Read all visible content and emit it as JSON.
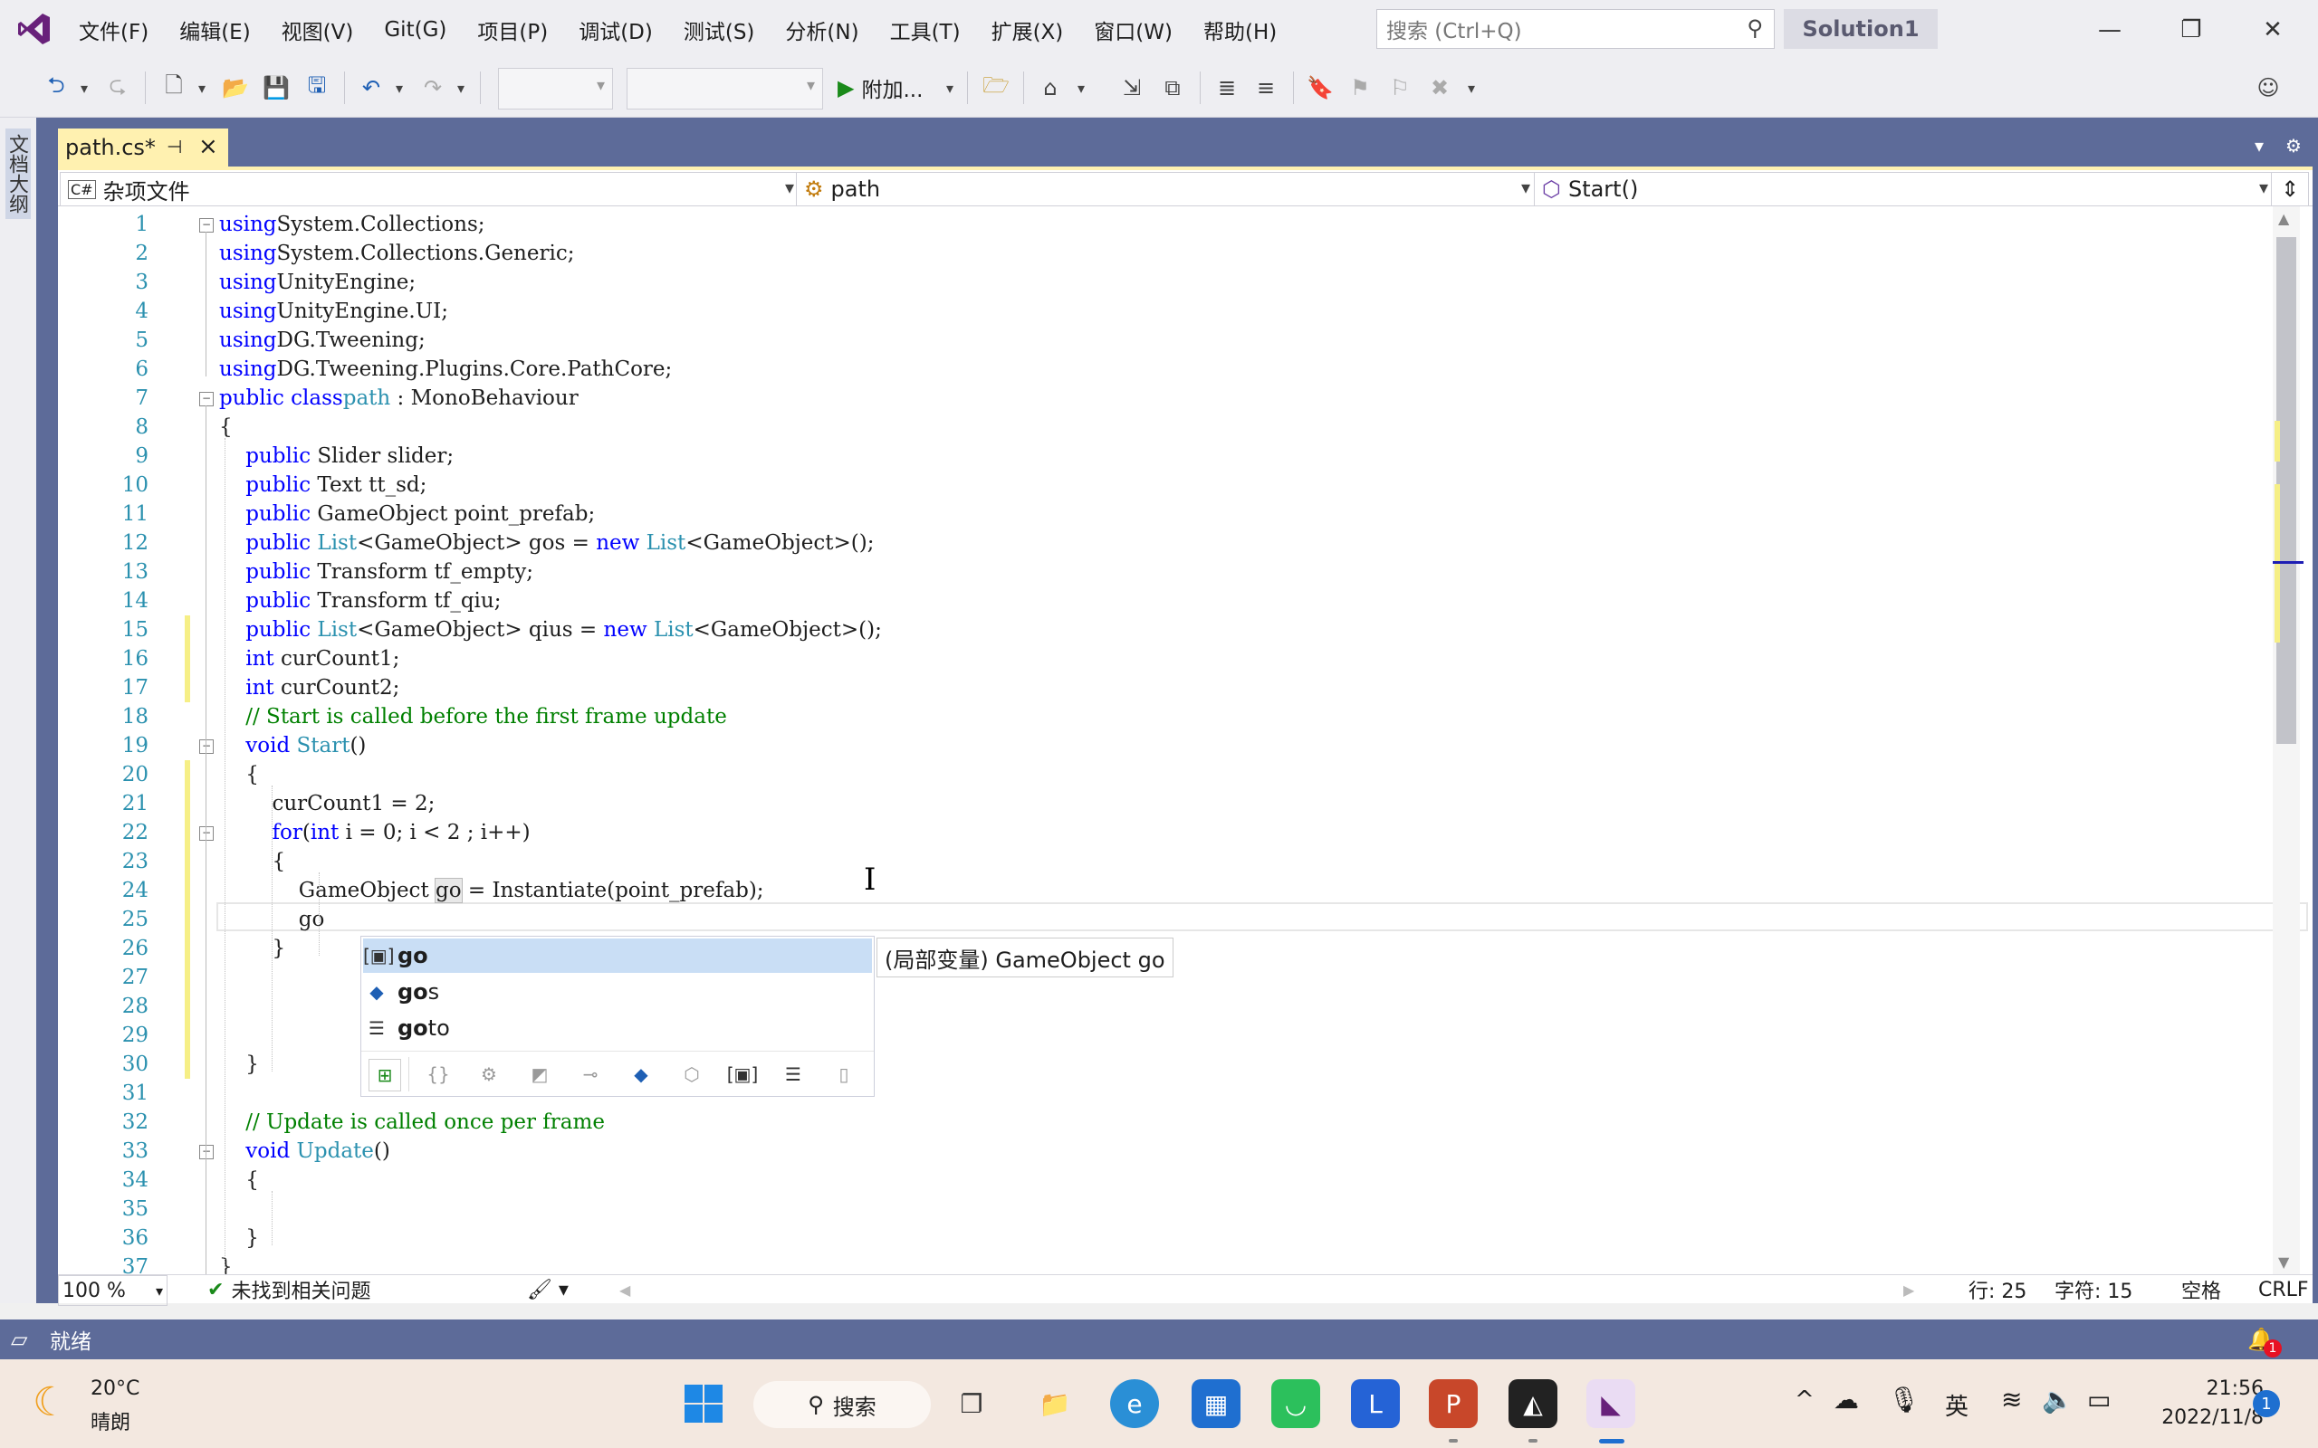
{
  "titlebar": {
    "menus": [
      "文件(F)",
      "编辑(E)",
      "视图(V)",
      "Git(G)",
      "项目(P)",
      "调试(D)",
      "测试(S)",
      "分析(N)",
      "工具(T)",
      "扩展(X)",
      "窗口(W)",
      "帮助(H)"
    ],
    "search_placeholder": "搜索 (Ctrl+Q)",
    "solution": "Solution1"
  },
  "toolbar": {
    "attach_label": "附加..."
  },
  "left_panel_label": "文档大纲",
  "tab": {
    "title": "path.cs*"
  },
  "navbar": {
    "project": "杂项文件",
    "class": "path",
    "member": "Start()"
  },
  "code_lines": [
    {
      "n": "1",
      "p": [
        [
          "kw",
          "using"
        ],
        [
          "",
          "System.Collections;"
        ]
      ]
    },
    {
      "n": "2",
      "p": [
        [
          "kw",
          "using"
        ],
        [
          "",
          "System.Collections.Generic;"
        ]
      ]
    },
    {
      "n": "3",
      "p": [
        [
          "kw",
          "using"
        ],
        [
          "",
          "UnityEngine;"
        ]
      ]
    },
    {
      "n": "4",
      "p": [
        [
          "kw",
          "using"
        ],
        [
          "",
          "UnityEngine.UI;"
        ]
      ]
    },
    {
      "n": "5",
      "p": [
        [
          "kw",
          "using"
        ],
        [
          "",
          "DG.Tweening;"
        ]
      ]
    },
    {
      "n": "6",
      "p": [
        [
          "kw",
          "using"
        ],
        [
          "",
          "DG.Tweening.Plugins.Core.PathCore;"
        ]
      ]
    },
    {
      "n": "7",
      "p": [
        [
          "kw",
          "public class"
        ],
        [
          "ty",
          "path"
        ],
        [
          "",
          " : MonoBehaviour"
        ]
      ]
    },
    {
      "n": "8",
      "p": [
        [
          "",
          "{"
        ]
      ]
    },
    {
      "n": "9",
      "p": [
        [
          "",
          "    "
        ],
        [
          "kw",
          "public"
        ],
        [
          "",
          " Slider slider;"
        ]
      ]
    },
    {
      "n": "10",
      "p": [
        [
          "",
          "    "
        ],
        [
          "kw",
          "public"
        ],
        [
          "",
          " Text tt_sd;"
        ]
      ]
    },
    {
      "n": "11",
      "p": [
        [
          "",
          "    "
        ],
        [
          "kw",
          "public"
        ],
        [
          "",
          " GameObject point_prefab;"
        ]
      ]
    },
    {
      "n": "12",
      "p": [
        [
          "",
          "    "
        ],
        [
          "kw",
          "public"
        ],
        [
          "",
          " "
        ],
        [
          "ty",
          "List"
        ],
        [
          "",
          "<GameObject> gos = "
        ],
        [
          "kw",
          "new"
        ],
        [
          "",
          " "
        ],
        [
          "ty",
          "List"
        ],
        [
          "",
          "<GameObject>();"
        ]
      ]
    },
    {
      "n": "13",
      "p": [
        [
          "",
          "    "
        ],
        [
          "kw",
          "public"
        ],
        [
          "",
          " Transform tf_empty;"
        ]
      ]
    },
    {
      "n": "14",
      "p": [
        [
          "",
          "    "
        ],
        [
          "kw",
          "public"
        ],
        [
          "",
          " Transform tf_qiu;"
        ]
      ]
    },
    {
      "n": "15",
      "p": [
        [
          "",
          "    "
        ],
        [
          "kw",
          "public"
        ],
        [
          "",
          " "
        ],
        [
          "ty",
          "List"
        ],
        [
          "",
          "<GameObject> qius = "
        ],
        [
          "kw",
          "new"
        ],
        [
          "",
          " "
        ],
        [
          "ty",
          "List"
        ],
        [
          "",
          "<GameObject>();"
        ]
      ]
    },
    {
      "n": "16",
      "p": [
        [
          "",
          "    "
        ],
        [
          "kw",
          "int"
        ],
        [
          "",
          " curCount1;"
        ]
      ]
    },
    {
      "n": "17",
      "p": [
        [
          "",
          "    "
        ],
        [
          "kw",
          "int"
        ],
        [
          "",
          " curCount2;"
        ]
      ]
    },
    {
      "n": "18",
      "p": [
        [
          "",
          "    "
        ],
        [
          "cm",
          "// Start is called before the first frame update"
        ]
      ]
    },
    {
      "n": "19",
      "p": [
        [
          "",
          "    "
        ],
        [
          "kw",
          "void"
        ],
        [
          "",
          " "
        ],
        [
          "ty",
          "Start"
        ],
        [
          "",
          "()"
        ]
      ]
    },
    {
      "n": "20",
      "p": [
        [
          "",
          "    {"
        ]
      ]
    },
    {
      "n": "21",
      "p": [
        [
          "",
          "        curCount1 = 2;"
        ]
      ]
    },
    {
      "n": "22",
      "p": [
        [
          "",
          "        "
        ],
        [
          "kw",
          "for"
        ],
        [
          "",
          "("
        ],
        [
          "kw",
          "int"
        ],
        [
          "",
          " i = 0; i < 2 ; i++)"
        ]
      ]
    },
    {
      "n": "23",
      "p": [
        [
          "",
          "        {"
        ]
      ]
    },
    {
      "n": "24",
      "p": [
        [
          "",
          "            GameObject "
        ],
        [
          "hl",
          "go"
        ],
        [
          "",
          " = Instantiate(point_prefab);"
        ]
      ]
    },
    {
      "n": "25",
      "p": [
        [
          "",
          "            go"
        ]
      ]
    },
    {
      "n": "26",
      "p": [
        [
          "",
          "        }"
        ]
      ]
    },
    {
      "n": "27",
      "p": []
    },
    {
      "n": "28",
      "p": []
    },
    {
      "n": "29",
      "p": []
    },
    {
      "n": "30",
      "p": [
        [
          "",
          "    }"
        ]
      ]
    },
    {
      "n": "31",
      "p": []
    },
    {
      "n": "32",
      "p": [
        [
          "",
          "    "
        ],
        [
          "cm",
          "// Update is called once per frame"
        ]
      ]
    },
    {
      "n": "33",
      "p": [
        [
          "",
          "    "
        ],
        [
          "kw",
          "void"
        ],
        [
          "",
          " "
        ],
        [
          "ty",
          "Update"
        ],
        [
          "",
          "()"
        ]
      ]
    },
    {
      "n": "34",
      "p": [
        [
          "",
          "    {"
        ]
      ]
    },
    {
      "n": "35",
      "p": []
    },
    {
      "n": "36",
      "p": [
        [
          "",
          "    }"
        ]
      ]
    },
    {
      "n": "37",
      "p": [
        [
          "",
          "}"
        ]
      ]
    }
  ],
  "completion": {
    "items": [
      {
        "label": "go",
        "icon": "local-variable-icon"
      },
      {
        "label": "gos",
        "icon": "field-icon"
      },
      {
        "label": "goto",
        "icon": "keyword-icon"
      }
    ],
    "tooltip": "(局部变量) GameObject go"
  },
  "editor_status": {
    "zoom": "100 %",
    "issues": "未找到相关问题",
    "line": "行: 25",
    "col": "字符: 15",
    "indent": "空格",
    "eol": "CRLF"
  },
  "statusbar": {
    "ready": "就绪",
    "notifications": "1"
  },
  "taskbar": {
    "weather_temp": "20°C",
    "weather_desc": "晴朗",
    "search_label": "搜索",
    "ime": "英",
    "time": "21:56",
    "date": "2022/11/8",
    "notif_count": "1"
  },
  "colors": {
    "accent": "#68217a",
    "doc_well": "#5d6b99",
    "tab_active": "#fff1b0",
    "keyword": "#0000ff",
    "type": "#2b91af",
    "comment": "#008000"
  }
}
